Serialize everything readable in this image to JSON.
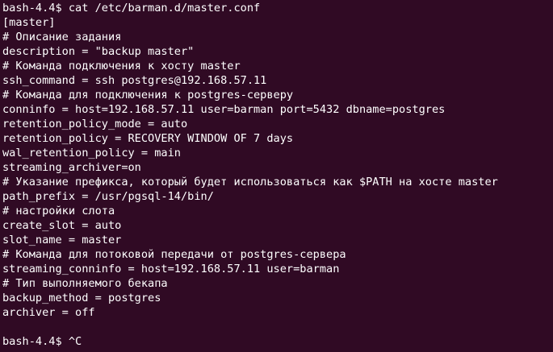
{
  "terminal": {
    "background_color": "#300a24",
    "text_color": "#ffffff",
    "command_line": "bash-4.4$ cat /etc/barman.d/master.conf",
    "lines": [
      "[master]",
      "# Описание задания",
      "description = \"backup master\"",
      "# Команда подключения к хосту master",
      "ssh_command = ssh postgres@192.168.57.11",
      "# Команда для подключения к postgres-серверу",
      "conninfo = host=192.168.57.11 user=barman port=5432 dbname=postgres",
      "retention_policy_mode = auto",
      "retention_policy = RECOVERY WINDOW OF 7 days",
      "wal_retention_policy = main",
      "streaming_archiver=on",
      "# Указание префикса, который будет использоваться как $PATH на хосте master",
      "path_prefix = /usr/pgsql-14/bin/",
      "# настройки слота",
      "create_slot = auto",
      "slot_name = master",
      "# Команда для потоковой передачи от postgres-сервера",
      "streaming_conninfo = host=192.168.57.11 user=barman",
      "# Тип выполняемого бекапа",
      "backup_method = postgres",
      "archiver = off"
    ],
    "final_prompt": "bash-4.4$ ^C"
  }
}
